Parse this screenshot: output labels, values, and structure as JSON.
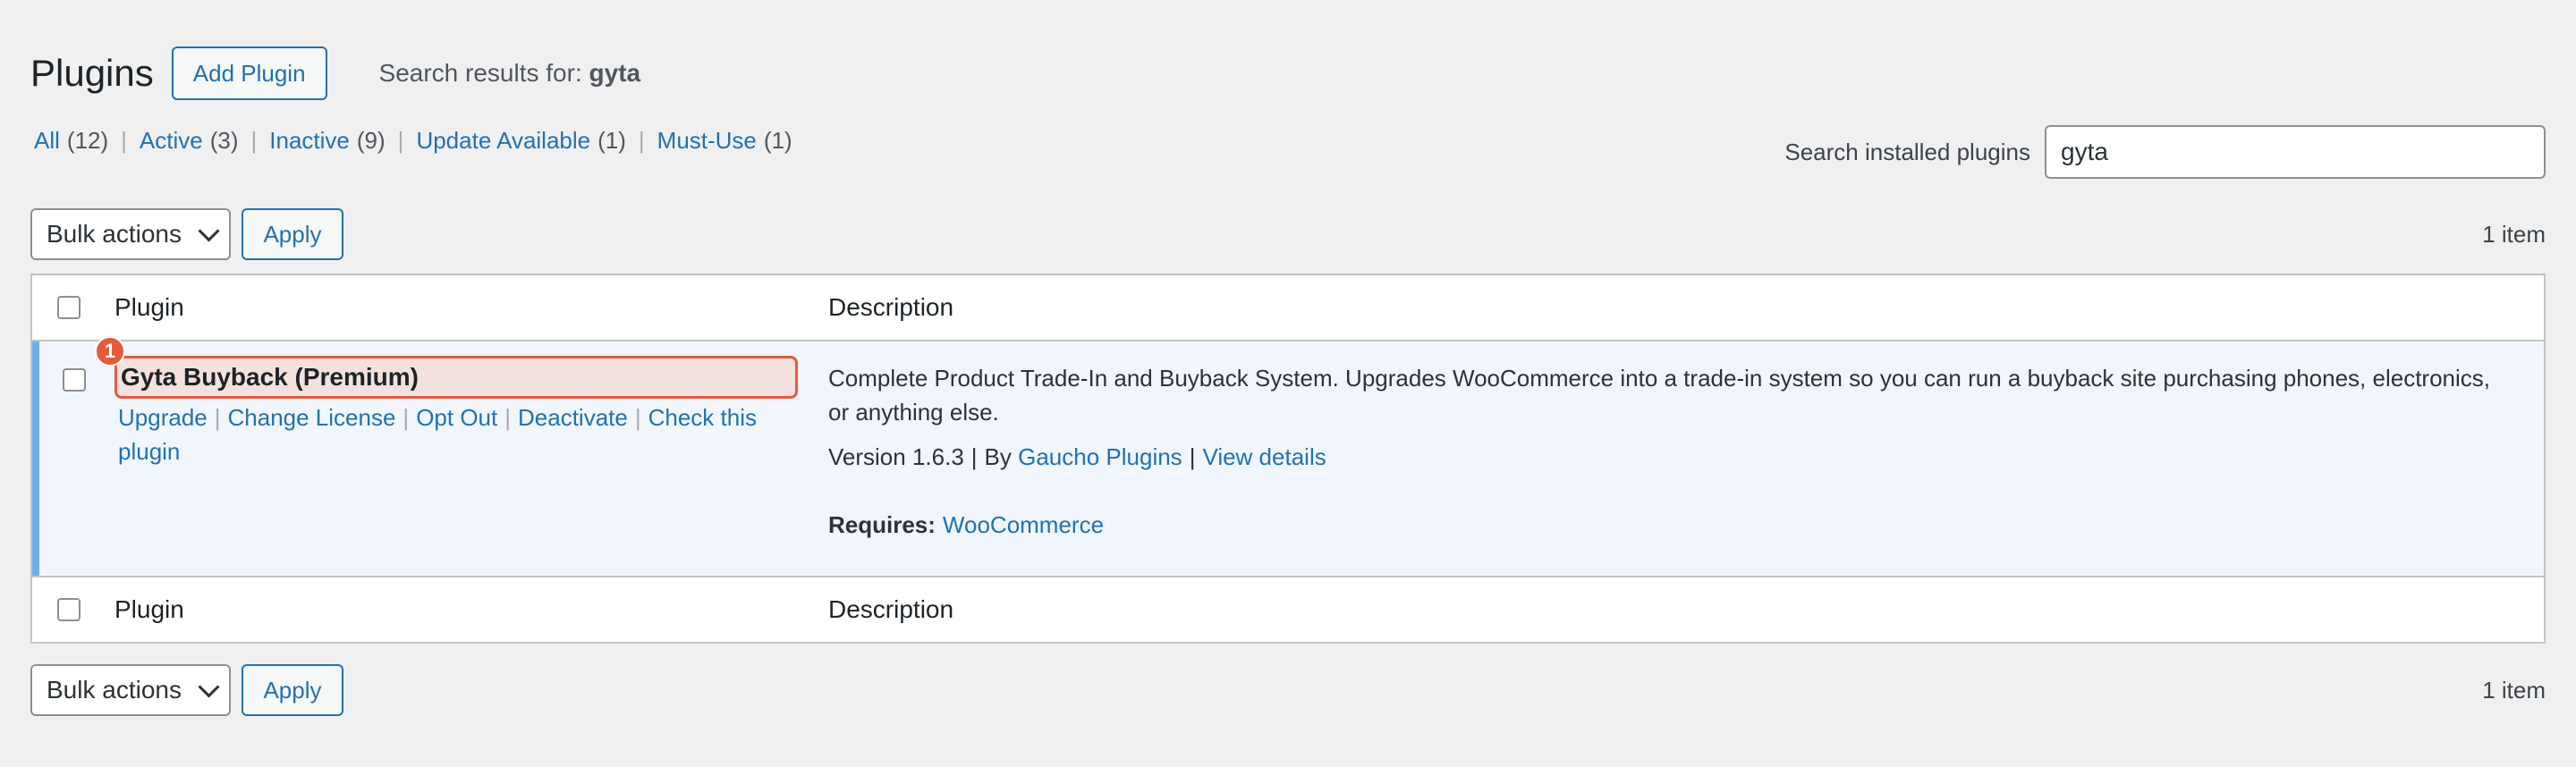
{
  "header": {
    "title": "Plugins",
    "add_button": "Add Plugin",
    "search_results_prefix": "Search results for: ",
    "search_term": "gyta"
  },
  "filters": [
    {
      "label": "All",
      "count": "(12)"
    },
    {
      "label": "Active",
      "count": "(3)"
    },
    {
      "label": "Inactive",
      "count": "(9)"
    },
    {
      "label": "Update Available",
      "count": "(1)"
    },
    {
      "label": "Must-Use",
      "count": "(1)"
    }
  ],
  "filter_separator": "|",
  "search": {
    "label": "Search installed plugins",
    "value": "gyta"
  },
  "tablenav": {
    "bulk_actions": "Bulk actions",
    "apply": "Apply",
    "items": "1 item"
  },
  "columns": {
    "plugin": "Plugin",
    "description": "Description"
  },
  "plugin_row": {
    "marker": "1",
    "name": "Gyta Buyback (Premium)",
    "actions": [
      "Upgrade",
      "Change License",
      "Opt Out",
      "Deactivate",
      "Check this plugin"
    ],
    "description": "Complete Product Trade-In and Buyback System. Upgrades WooCommerce into a trade-in system so you can run a buyback site purchasing phones, electronics, or anything else.",
    "version": "Version 1.6.3",
    "by": "By",
    "author": "Gaucho Plugins",
    "view_details": "View details",
    "requires_label": "Requires:",
    "requires_value": "WooCommerce"
  },
  "colors": {
    "accent": "#2271b1",
    "active_border": "#72aee6",
    "highlight": "#e55b3a"
  }
}
